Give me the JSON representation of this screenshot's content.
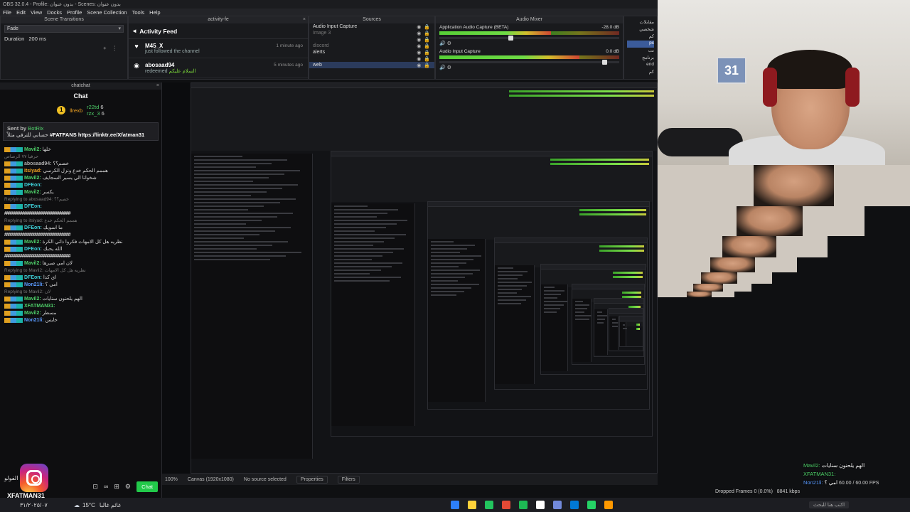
{
  "window": {
    "title": "OBS 32.0.4 - Profile: بدون عنوان - Scenes: بدون عنوان",
    "menu": [
      "File",
      "Edit",
      "View",
      "Docks",
      "Profile",
      "Scene Collection",
      "Tools",
      "Help"
    ]
  },
  "transitions": {
    "dock_title": "Scene Transitions",
    "type": "Fade",
    "duration_label": "Duration",
    "duration_value": "200 ms"
  },
  "activity": {
    "dock_title": "activity-fe",
    "title": "Activity Feed",
    "items": [
      {
        "user": "M45_X",
        "action": "just followed the channel",
        "time": "1 minute ago",
        "icon": "heart-icon"
      },
      {
        "user": "abosaad94",
        "action": "redeemed",
        "reward": "السلام عليكم",
        "time": "5 minutes ago",
        "icon": "reward-icon"
      }
    ]
  },
  "sources": {
    "dock_title": "Sources",
    "items": [
      {
        "name": "Audio Input Capture",
        "sub": ""
      },
      {
        "name": "Image 3",
        "sub": ""
      },
      {
        "name": "",
        "sub": ""
      },
      {
        "name": "discord",
        "sub": ""
      },
      {
        "name": "alerts",
        "sub": ""
      },
      {
        "name": "",
        "sub": ""
      },
      {
        "name": "web",
        "sub": ""
      }
    ]
  },
  "mixer": {
    "dock_title": "Audio Mixer",
    "channels": [
      {
        "name": "Application Audio Capture (BETA)",
        "db": "-28.0 dB",
        "level": 0.62,
        "fader": 0.4
      },
      {
        "name": "Audio Input Capture",
        "db": "0.0 dB",
        "level": 0.78,
        "fader": 0.92
      }
    ]
  },
  "scenes": {
    "items": [
      "مقابلات",
      "شخصي",
      "كم",
      "pc",
      "نت",
      "برنامج",
      "end",
      "كم"
    ],
    "active_index": 3
  },
  "chat": {
    "dock_title": "chatchat",
    "title": "Chat",
    "leaders": [
      {
        "rank": "1",
        "name": "llrexb",
        "count": ""
      },
      {
        "rank": "",
        "name": "r22td",
        "count": "6"
      },
      {
        "rank": "",
        "name": "rzx_3",
        "count": "6"
      }
    ],
    "pinned": {
      "by_label": "Sent by",
      "by_user": "BotRix",
      "text": "#FATFANS",
      "link": "https://linktr.ee/Xfatman31",
      "arabic": "حسابي للترفي مثلاً"
    },
    "messages": [
      {
        "user": "Mavil2:",
        "text": "خلها",
        "cls": "u-green",
        "reply": ""
      },
      {
        "user": "",
        "text": "",
        "cls": "",
        "reply": "حرفيا ٧٧ الرصاص"
      },
      {
        "user": "abosaad94:",
        "text": "خصم؟؟",
        "cls": "u-gray",
        "reply": ""
      },
      {
        "user": "itsiyad:",
        "text": "هممم الحكم خدع ونزل الكرسي",
        "cls": "u-orange",
        "reply": ""
      },
      {
        "user": "Mavil2:",
        "text": "شخوانا الي يسير السجايف",
        "cls": "u-green",
        "reply": ""
      },
      {
        "user": "DFEon:",
        "text": "",
        "cls": "u-cyan",
        "reply": ""
      },
      {
        "user": "Mavil2:",
        "text": "يكسر",
        "cls": "u-green",
        "reply": ""
      },
      {
        "user": "",
        "text": "",
        "cls": "",
        "reply": "Replying to abosaad94: خصم؟؟"
      },
      {
        "user": "DFEon:",
        "text": "",
        "cls": "u-cyan",
        "reply": ""
      },
      {
        "user": "",
        "text": "################################",
        "cls": "hashes",
        "reply": ""
      },
      {
        "user": "",
        "text": "",
        "cls": "",
        "reply": "Replying to itsiyad: هممم الحكم خدع"
      },
      {
        "user": "DFEon:",
        "text": "ما اسويك",
        "cls": "u-cyan",
        "reply": ""
      },
      {
        "user": "",
        "text": "################################",
        "cls": "hashes",
        "reply": ""
      },
      {
        "user": "Mavil2:",
        "text": "نظريه هل كل الامهات فكروا ذاتي الكرة",
        "cls": "u-green",
        "reply": ""
      },
      {
        "user": "DFEon:",
        "text": "الله يحبك",
        "cls": "u-cyan",
        "reply": ""
      },
      {
        "user": "",
        "text": "################################",
        "cls": "hashes",
        "reply": ""
      },
      {
        "user": "Mavil2:",
        "text": "لان امي صبرها",
        "cls": "u-green",
        "reply": ""
      },
      {
        "user": "",
        "text": "",
        "cls": "",
        "reply": "Replying to Mavil2: نظريه هل كل الامهات"
      },
      {
        "user": "DFEon:",
        "text": "اي كذا",
        "cls": "u-cyan",
        "reply": ""
      },
      {
        "user": "Non21li:",
        "text": "امي ؟",
        "cls": "u-blue",
        "reply": ""
      },
      {
        "user": "",
        "text": "",
        "cls": "",
        "reply": "Replying to Mavil2: لان"
      },
      {
        "user": "Mavil2:",
        "text": "الهم يلحنون سنايات",
        "cls": "u-green",
        "reply": ""
      },
      {
        "user": "XFATMAN31:",
        "text": "",
        "cls": "u-green",
        "reply": ""
      },
      {
        "user": "Mavil2:",
        "text": "مسطر",
        "cls": "u-green",
        "reply": ""
      },
      {
        "user": "Non21li:",
        "text": "خايس",
        "cls": "u-blue",
        "reply": ""
      }
    ],
    "overlay_top_text": "لاتنسى الفولو",
    "overlay_brand": "XFATMAN31",
    "send_label": "Chat"
  },
  "status": {
    "no_source": "No source selected",
    "properties": "Properties",
    "filters": "Filters",
    "zoom": "100%",
    "canvas": "Canvas (1920x1080)"
  },
  "right_chat": [
    {
      "user": "Mavil2:",
      "text": "الهم يلحنون سنايات"
    },
    {
      "user": "XFATMAN31:",
      "text": ""
    },
    {
      "user": "Non21li:",
      "text": "امي ؟"
    }
  ],
  "stream": {
    "dropped": "Dropped Frames 0 (0.0%)",
    "bitrate": "8841 kbps",
    "fps": "60.00 / 60.00 FPS"
  },
  "taskbar": {
    "weather_temp": "15°C",
    "weather_label": "غائم غالبا",
    "date": "٣١/٢٠٢٥/٠٧",
    "search_placeholder": "اكتب هنا للبحث",
    "icon_colors": [
      "#2d7ff9",
      "#ffd23a",
      "#22c55e",
      "#e34a36",
      "#1db954",
      "#ffffff",
      "#7289da",
      "#0078d4",
      "#25d366",
      "#ff9900"
    ]
  },
  "webcam": {
    "calendar": "31"
  }
}
